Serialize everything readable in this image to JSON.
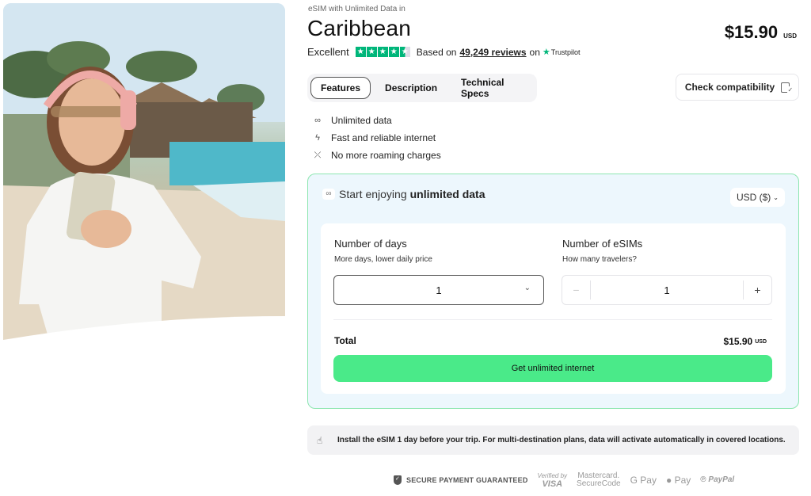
{
  "product": {
    "subtitle": "eSIM with Unlimited Data in",
    "title": "Caribbean",
    "price": "$15.90",
    "currency": "USD"
  },
  "rating": {
    "label": "Excellent",
    "stars": 4.5,
    "based_on": "Based on",
    "reviews": "49,249 reviews",
    "on": "on",
    "provider": "Trustpilot",
    "star_color": "#00b67a"
  },
  "tabs": [
    {
      "label": "Features",
      "active": true
    },
    {
      "label": "Description",
      "active": false
    },
    {
      "label": "Technical Specs",
      "active": false
    }
  ],
  "check_compatibility": {
    "label": "Check compatibility",
    "icon": "phone-check-icon"
  },
  "features": [
    {
      "icon": "infinity-icon",
      "glyph": "∞",
      "label": "Unlimited data"
    },
    {
      "icon": "lightning-icon",
      "glyph": "ϟ",
      "label": "Fast and reliable internet"
    },
    {
      "icon": "no-roaming-icon",
      "glyph": "⤫",
      "label": "No more roaming charges"
    }
  ],
  "plan": {
    "heading_prefix": "Start enjoying",
    "heading_bold": "unlimited data",
    "currency_select": "USD ($)",
    "days": {
      "label": "Number of days",
      "sub": "More days, lower daily price",
      "value": "1"
    },
    "esims": {
      "label": "Number of eSIMs",
      "sub": "How many travelers?",
      "value": "1",
      "minus": "−",
      "plus": "+"
    },
    "total_label": "Total",
    "total_price": "$15.90",
    "total_currency": "USD",
    "cta": "Get unlimited internet",
    "accent": "#4aea89"
  },
  "info": {
    "icon": "tap-hand-icon",
    "text": "Install the eSIM 1 day before your trip. For multi-destination plans, data will activate automatically in covered locations."
  },
  "payments": {
    "secure": "SECURE PAYMENT GUARANTEED",
    "visa_top": "Verified by",
    "visa_bottom": "VISA",
    "mc_top": "Mastercard.",
    "mc_bottom": "SecureCode",
    "gpay": "G Pay",
    "apay": " Pay",
    "paypal": "PayPal"
  }
}
